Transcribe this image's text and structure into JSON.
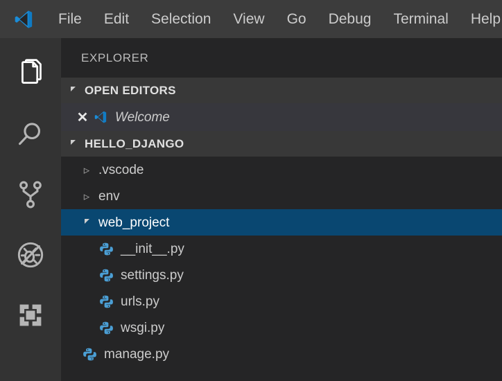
{
  "window": {
    "app_logo": "vscode-logo",
    "background": "#1e1e1e"
  },
  "menubar": {
    "background": "#3c3c3c",
    "items": [
      {
        "label": "File",
        "name": "menu-file"
      },
      {
        "label": "Edit",
        "name": "menu-edit"
      },
      {
        "label": "Selection",
        "name": "menu-selection"
      },
      {
        "label": "View",
        "name": "menu-view"
      },
      {
        "label": "Go",
        "name": "menu-go"
      },
      {
        "label": "Debug",
        "name": "menu-debug"
      },
      {
        "label": "Terminal",
        "name": "menu-terminal"
      },
      {
        "label": "Help",
        "name": "menu-help"
      }
    ]
  },
  "activitybar": {
    "background": "#333333",
    "items": [
      {
        "icon": "files-explorer-icon",
        "title": "Explorer",
        "active": true
      },
      {
        "icon": "search-icon",
        "title": "Search",
        "active": false
      },
      {
        "icon": "source-control-icon",
        "title": "Source Control",
        "active": false
      },
      {
        "icon": "debug-no-icon",
        "title": "Debug",
        "active": false
      },
      {
        "icon": "extensions-icon",
        "title": "Extensions",
        "active": false
      }
    ]
  },
  "sidebar": {
    "title": "EXPLORER",
    "background": "#252526",
    "open_editors": {
      "label": "OPEN EDITORS",
      "expanded": true,
      "items": [
        {
          "label": "Welcome",
          "icon": "vscode-logo",
          "close": "✕",
          "italic": true
        }
      ]
    },
    "folder": {
      "label": "HELLO_DJANGO",
      "expanded": true,
      "items": [
        {
          "label": ".vscode",
          "type": "folder",
          "expanded": false,
          "indent": 1,
          "selected": false
        },
        {
          "label": "env",
          "type": "folder",
          "expanded": false,
          "indent": 1,
          "selected": false
        },
        {
          "label": "web_project",
          "type": "folder",
          "expanded": true,
          "indent": 1,
          "selected": true
        },
        {
          "label": "__init__.py",
          "type": "python",
          "indent": 2,
          "selected": false
        },
        {
          "label": "settings.py",
          "type": "python",
          "indent": 2,
          "selected": false
        },
        {
          "label": "urls.py",
          "type": "python",
          "indent": 2,
          "selected": false
        },
        {
          "label": "wsgi.py",
          "type": "python",
          "indent": 2,
          "selected": false
        },
        {
          "label": "manage.py",
          "type": "python",
          "indent": 0,
          "selected": false
        }
      ]
    }
  },
  "colors": {
    "selection_blue": "#094771",
    "python_icon_blue": "#4b9fd5",
    "vscode_blue": "#0f7bc4",
    "header_gray": "#383838",
    "text": "#cccccc"
  }
}
